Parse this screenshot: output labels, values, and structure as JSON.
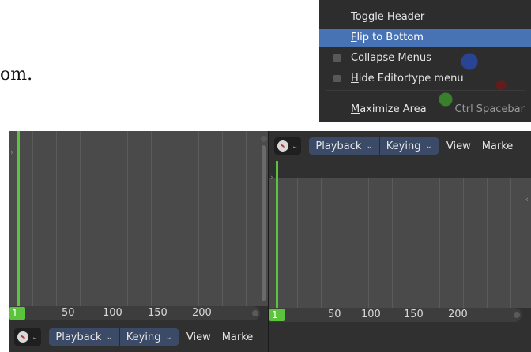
{
  "document": {
    "text_fragment": "om."
  },
  "context_menu": {
    "items": [
      {
        "label": "Toggle Header",
        "mnemonic": "T",
        "rest": "oggle Header",
        "checkbox": false,
        "active": false,
        "shortcut": ""
      },
      {
        "label": "Flip to Bottom",
        "mnemonic": "F",
        "rest": "lip to Bottom",
        "checkbox": false,
        "active": true,
        "shortcut": ""
      },
      {
        "label": "Collapse Menus",
        "mnemonic": "C",
        "rest": "ollapse Menus",
        "checkbox": true,
        "active": false,
        "shortcut": ""
      },
      {
        "label": "Hide Editortype menu",
        "mnemonic": "H",
        "rest": "ide Editortype menu",
        "checkbox": true,
        "active": false,
        "shortcut": ""
      },
      {
        "label": "Maximize Area",
        "mnemonic": "M",
        "rest": "aximize Area",
        "checkbox": false,
        "active": false,
        "shortcut": "Ctrl Spacebar"
      }
    ],
    "colors": {
      "background": "#2b2b2b",
      "highlight": "#4772b3"
    }
  },
  "editors": {
    "left": {
      "header_position": "bottom",
      "menus": {
        "playback": "Playback",
        "keying": "Keying",
        "view": "View",
        "marker": "Marke"
      },
      "current_frame": "1",
      "ticks": [
        "50",
        "100",
        "150",
        "200"
      ]
    },
    "right": {
      "header_position": "top",
      "menus": {
        "playback": "Playback",
        "keying": "Keying",
        "view": "View",
        "marker": "Marke"
      },
      "current_frame": "1",
      "ticks": [
        "50",
        "100",
        "150",
        "200"
      ]
    },
    "icons": {
      "editor_type": "clock-icon",
      "dropdown": "chevron-down-icon"
    },
    "colors": {
      "playhead": "#5cc43c",
      "menu_button": "#3b4a66",
      "grid": "#4a4a4a"
    }
  }
}
